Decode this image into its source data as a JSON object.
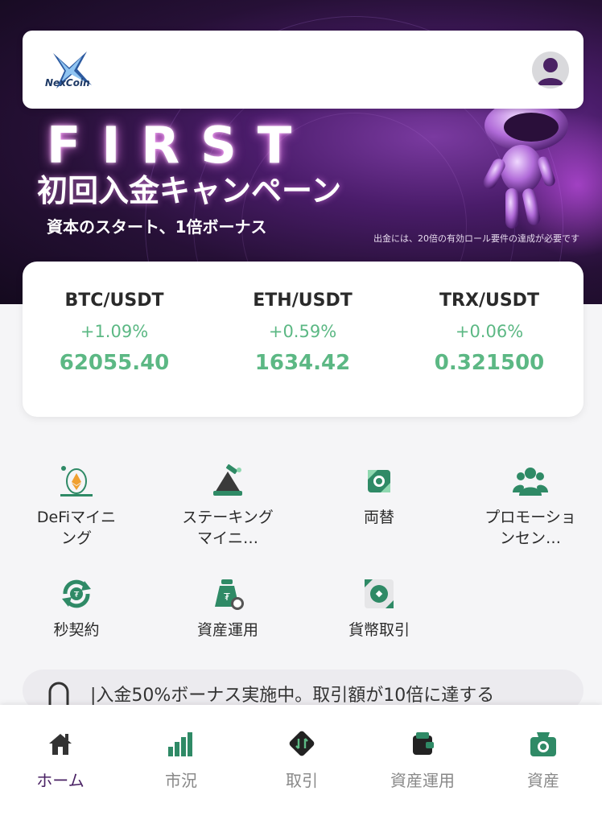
{
  "header": {
    "logo_text": "NexCoin"
  },
  "banner": {
    "headline": "FIRST",
    "title": "初回入金キャンペーン",
    "subtitle": "資本のスタート、1倍ボーナス",
    "note": "出金には、20倍の有効ロール要件の達成が必要です"
  },
  "ticker": [
    {
      "pair": "BTC/USDT",
      "change": "+1.09%",
      "price": "62055.40"
    },
    {
      "pair": "ETH/USDT",
      "change": "+0.59%",
      "price": "1634.42"
    },
    {
      "pair": "TRX/USDT",
      "change": "+0.06%",
      "price": "0.321500"
    }
  ],
  "menu": [
    {
      "label": "DeFiマイニング",
      "icon": "defi-mining-icon"
    },
    {
      "label": "ステーキングマイニ…",
      "icon": "staking-icon"
    },
    {
      "label": "両替",
      "icon": "exchange-icon"
    },
    {
      "label": "プロモーションセン…",
      "icon": "promotion-icon"
    },
    {
      "label": "秒契約",
      "icon": "second-contract-icon"
    },
    {
      "label": "資産運用",
      "icon": "asset-management-icon"
    },
    {
      "label": "貨幣取引",
      "icon": "currency-trade-icon"
    }
  ],
  "notice": {
    "text": "|入金50%ボーナス実施中。取引額が10倍に達する"
  },
  "nav": [
    {
      "label": "ホーム",
      "icon": "home-icon",
      "active": true
    },
    {
      "label": "市況",
      "icon": "market-icon",
      "active": false
    },
    {
      "label": "取引",
      "icon": "trade-icon",
      "active": false
    },
    {
      "label": "資産運用",
      "icon": "wallet-icon",
      "active": false
    },
    {
      "label": "資産",
      "icon": "assets-icon",
      "active": false
    }
  ],
  "colors": {
    "accent_green": "#5cb884",
    "icon_green": "#2f8a66",
    "active_purple": "#4a2264"
  }
}
